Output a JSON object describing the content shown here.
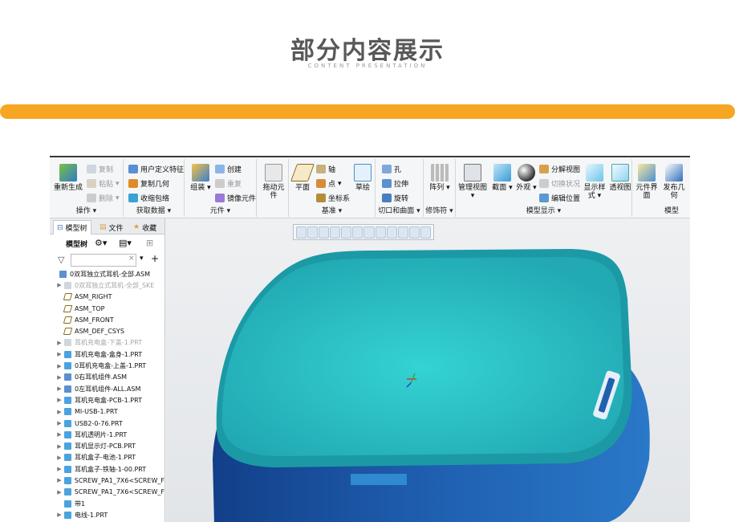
{
  "header": {
    "title": "部分内容展示",
    "subtitle": "CONTENT PRESENTATION"
  },
  "colors": {
    "accent": "#f6a623",
    "lid": "#2fc4c4",
    "body": "#1f5fb0"
  },
  "ribbon": {
    "ops": {
      "label": "操作",
      "regen": "重新生成",
      "copy": "复制",
      "paste": "粘贴",
      "delete": "删除"
    },
    "getdata": {
      "label": "获取数据",
      "udf": "用户定义特征",
      "copygeom": "复制几何",
      "shrinkwrap": "收缩包络"
    },
    "component": {
      "label": "元件",
      "assemble": "组装",
      "create": "创建",
      "repeat": "重复",
      "mirror": "镜像元件"
    },
    "drag": {
      "label": "拖动元件"
    },
    "datum": {
      "label": "基准",
      "plane": "平面",
      "axis": "轴",
      "point": "点",
      "csys": "坐标系",
      "sketch": "草绘"
    },
    "cut": {
      "label": "切口和曲面",
      "hole": "孔",
      "extrude": "拉伸",
      "revolve": "旋转"
    },
    "modifiers": {
      "label": "修饰符",
      "pattern": "阵列"
    },
    "display": {
      "label": "模型显示",
      "manage": "管理视图",
      "section": "截面",
      "appearance": "外观",
      "explode": "分解视图",
      "toggle": "切换状况",
      "edit": "编辑位置",
      "style": "显示样式",
      "persp": "透视图"
    },
    "intent": {
      "label": "模型",
      "iface": "元件界面",
      "publish": "发布几何"
    }
  },
  "left": {
    "tabs": [
      "模型树",
      "文件",
      "收藏"
    ],
    "tree_label": "模型树",
    "filter_placeholder": ""
  },
  "tree": [
    {
      "t": "0双耳独立式耳机-全部.ASM",
      "dim": false,
      "tw": ""
    },
    {
      "t": "0双耳独立式耳机-全部_SKE",
      "dim": true,
      "tw": "▶"
    },
    {
      "t": "ASM_RIGHT",
      "dim": false,
      "tw": ""
    },
    {
      "t": "ASM_TOP",
      "dim": false,
      "tw": ""
    },
    {
      "t": "ASM_FRONT",
      "dim": false,
      "tw": ""
    },
    {
      "t": "ASM_DEF_CSYS",
      "dim": false,
      "tw": ""
    },
    {
      "t": "耳机充电盒-下盖-1.PRT",
      "dim": true,
      "tw": "▶"
    },
    {
      "t": "耳机充电盒-盒身-1.PRT",
      "dim": false,
      "tw": "▶"
    },
    {
      "t": "0耳机充电盒-上盖-1.PRT",
      "dim": false,
      "tw": "▶"
    },
    {
      "t": "0右耳机组件.ASM",
      "dim": false,
      "tw": "▶"
    },
    {
      "t": "0左耳机组件-ALL.ASM",
      "dim": false,
      "tw": "▶"
    },
    {
      "t": "耳机充电盒-PCB-1.PRT",
      "dim": false,
      "tw": "▶"
    },
    {
      "t": "MI-USB-1.PRT",
      "dim": false,
      "tw": "▶"
    },
    {
      "t": "USB2-0-76.PRT",
      "dim": false,
      "tw": "▶"
    },
    {
      "t": "耳机透明片-1.PRT",
      "dim": false,
      "tw": "▶"
    },
    {
      "t": "耳机显示灯-PCB.PRT",
      "dim": false,
      "tw": "▶"
    },
    {
      "t": "耳机盒子-电池-1.PRT",
      "dim": false,
      "tw": "▶"
    },
    {
      "t": "耳机盒子-铁轴-1-00.PRT",
      "dim": false,
      "tw": "▶"
    },
    {
      "t": "SCREW_PA1_7X6<SCREW_F",
      "dim": false,
      "tw": "▶"
    },
    {
      "t": "SCREW_PA1_7X6<SCREW_F",
      "dim": false,
      "tw": "▶"
    },
    {
      "t": "带1",
      "dim": false,
      "tw": ""
    },
    {
      "t": "电线-1.PRT",
      "dim": false,
      "tw": "▶"
    }
  ]
}
